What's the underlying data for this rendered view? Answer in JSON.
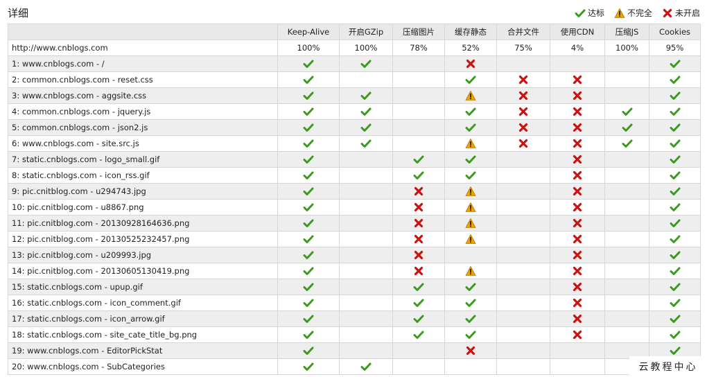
{
  "page": {
    "title": "详细"
  },
  "legend": [
    {
      "icon": "check",
      "label": "达标"
    },
    {
      "icon": "warn",
      "label": "不完全"
    },
    {
      "icon": "cross",
      "label": "未开启"
    }
  ],
  "columns": [
    "",
    "Keep-Alive",
    "开启GZip",
    "压缩图片",
    "缓存静态",
    "合并文件",
    "使用CDN",
    "压缩JS",
    "Cookies"
  ],
  "summary": {
    "name": "http://www.cnblogs.com",
    "values": [
      "100%",
      "100%",
      "78%",
      "52%",
      "75%",
      "4%",
      "100%",
      "95%"
    ]
  },
  "rows": [
    {
      "name": "1: www.cnblogs.com - /",
      "cells": [
        "check",
        "check",
        "",
        "cross",
        "",
        "",
        "",
        "check"
      ]
    },
    {
      "name": "2: common.cnblogs.com - reset.css",
      "cells": [
        "check",
        "",
        "",
        "check",
        "cross",
        "cross",
        "",
        "check"
      ]
    },
    {
      "name": "3: www.cnblogs.com - aggsite.css",
      "cells": [
        "check",
        "check",
        "",
        "warn",
        "cross",
        "cross",
        "",
        "check"
      ]
    },
    {
      "name": "4: common.cnblogs.com - jquery.js",
      "cells": [
        "check",
        "check",
        "",
        "check",
        "cross",
        "cross",
        "check",
        "check"
      ]
    },
    {
      "name": "5: common.cnblogs.com - json2.js",
      "cells": [
        "check",
        "check",
        "",
        "check",
        "cross",
        "cross",
        "check",
        "check"
      ]
    },
    {
      "name": "6: www.cnblogs.com - site.src.js",
      "cells": [
        "check",
        "check",
        "",
        "warn",
        "cross",
        "cross",
        "check",
        "check"
      ]
    },
    {
      "name": "7: static.cnblogs.com - logo_small.gif",
      "cells": [
        "check",
        "",
        "check",
        "check",
        "",
        "cross",
        "",
        "check"
      ]
    },
    {
      "name": "8: static.cnblogs.com - icon_rss.gif",
      "cells": [
        "check",
        "",
        "check",
        "check",
        "",
        "cross",
        "",
        "check"
      ]
    },
    {
      "name": "9: pic.cnitblog.com - u294743.jpg",
      "cells": [
        "check",
        "",
        "cross",
        "warn",
        "",
        "cross",
        "",
        "check"
      ]
    },
    {
      "name": "10: pic.cnitblog.com - u8867.png",
      "cells": [
        "check",
        "",
        "cross",
        "warn",
        "",
        "cross",
        "",
        "check"
      ]
    },
    {
      "name": "11: pic.cnitblog.com - 20130928164636.png",
      "cells": [
        "check",
        "",
        "cross",
        "warn",
        "",
        "cross",
        "",
        "check"
      ]
    },
    {
      "name": "12: pic.cnitblog.com - 20130525232457.png",
      "cells": [
        "check",
        "",
        "cross",
        "warn",
        "",
        "cross",
        "",
        "check"
      ]
    },
    {
      "name": "13: pic.cnitblog.com - u209993.jpg",
      "cells": [
        "check",
        "",
        "cross",
        "",
        "",
        "cross",
        "",
        "check"
      ]
    },
    {
      "name": "14: pic.cnitblog.com - 20130605130419.png",
      "cells": [
        "check",
        "",
        "cross",
        "warn",
        "",
        "cross",
        "",
        "check"
      ]
    },
    {
      "name": "15: static.cnblogs.com - upup.gif",
      "cells": [
        "check",
        "",
        "check",
        "check",
        "",
        "cross",
        "",
        "check"
      ]
    },
    {
      "name": "16: static.cnblogs.com - icon_comment.gif",
      "cells": [
        "check",
        "",
        "check",
        "check",
        "",
        "cross",
        "",
        "check"
      ]
    },
    {
      "name": "17: static.cnblogs.com - icon_arrow.gif",
      "cells": [
        "check",
        "",
        "check",
        "check",
        "",
        "cross",
        "",
        "check"
      ]
    },
    {
      "name": "18: static.cnblogs.com - site_cate_title_bg.png",
      "cells": [
        "check",
        "",
        "check",
        "check",
        "",
        "cross",
        "",
        "check"
      ]
    },
    {
      "name": "19: www.cnblogs.com - EditorPickStat",
      "cells": [
        "check",
        "",
        "",
        "cross",
        "",
        "",
        "",
        "check"
      ]
    },
    {
      "name": "20: www.cnblogs.com - SubCategories",
      "cells": [
        "check",
        "check",
        "",
        "",
        "",
        "",
        "",
        ""
      ]
    }
  ],
  "watermark": "云教程中心",
  "colors": {
    "check": "#3a9a1e",
    "cross": "#cc1111",
    "warn": "#f0a000",
    "header_bg": "#e9e9e9",
    "alt_row_bg": "#eeeeee"
  }
}
